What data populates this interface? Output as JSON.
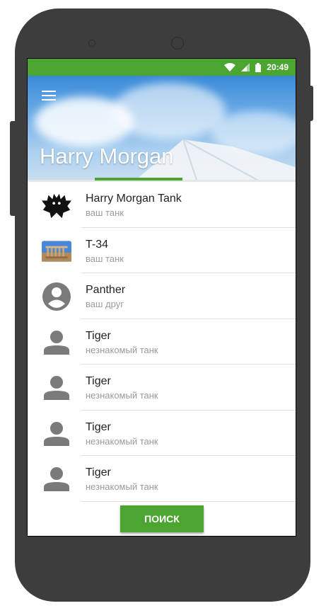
{
  "status_bar": {
    "time": "20:49"
  },
  "header": {
    "title": "Harry Morgan",
    "icon": "hamburger-menu-icon"
  },
  "contacts": [
    {
      "name": "Harry Morgan Tank",
      "subtitle": "ваш танк",
      "avatar": "bat-logo"
    },
    {
      "name": "T-34",
      "subtitle": "ваш танк",
      "avatar": "temple-photo"
    },
    {
      "name": "Panther",
      "subtitle": "ваш друг",
      "avatar": "account-circle-icon"
    },
    {
      "name": "Tiger",
      "subtitle": "незнакомый танк",
      "avatar": "person-icon"
    },
    {
      "name": "Tiger",
      "subtitle": "незнакомый танк",
      "avatar": "person-icon"
    },
    {
      "name": "Tiger",
      "subtitle": "незнакомый танк",
      "avatar": "person-icon"
    },
    {
      "name": "Tiger",
      "subtitle": "незнакомый танк",
      "avatar": "person-icon"
    }
  ],
  "footer": {
    "search_label": "поиск"
  },
  "colors": {
    "accent": "#4ca530",
    "phone_body": "#3d3d3d"
  }
}
